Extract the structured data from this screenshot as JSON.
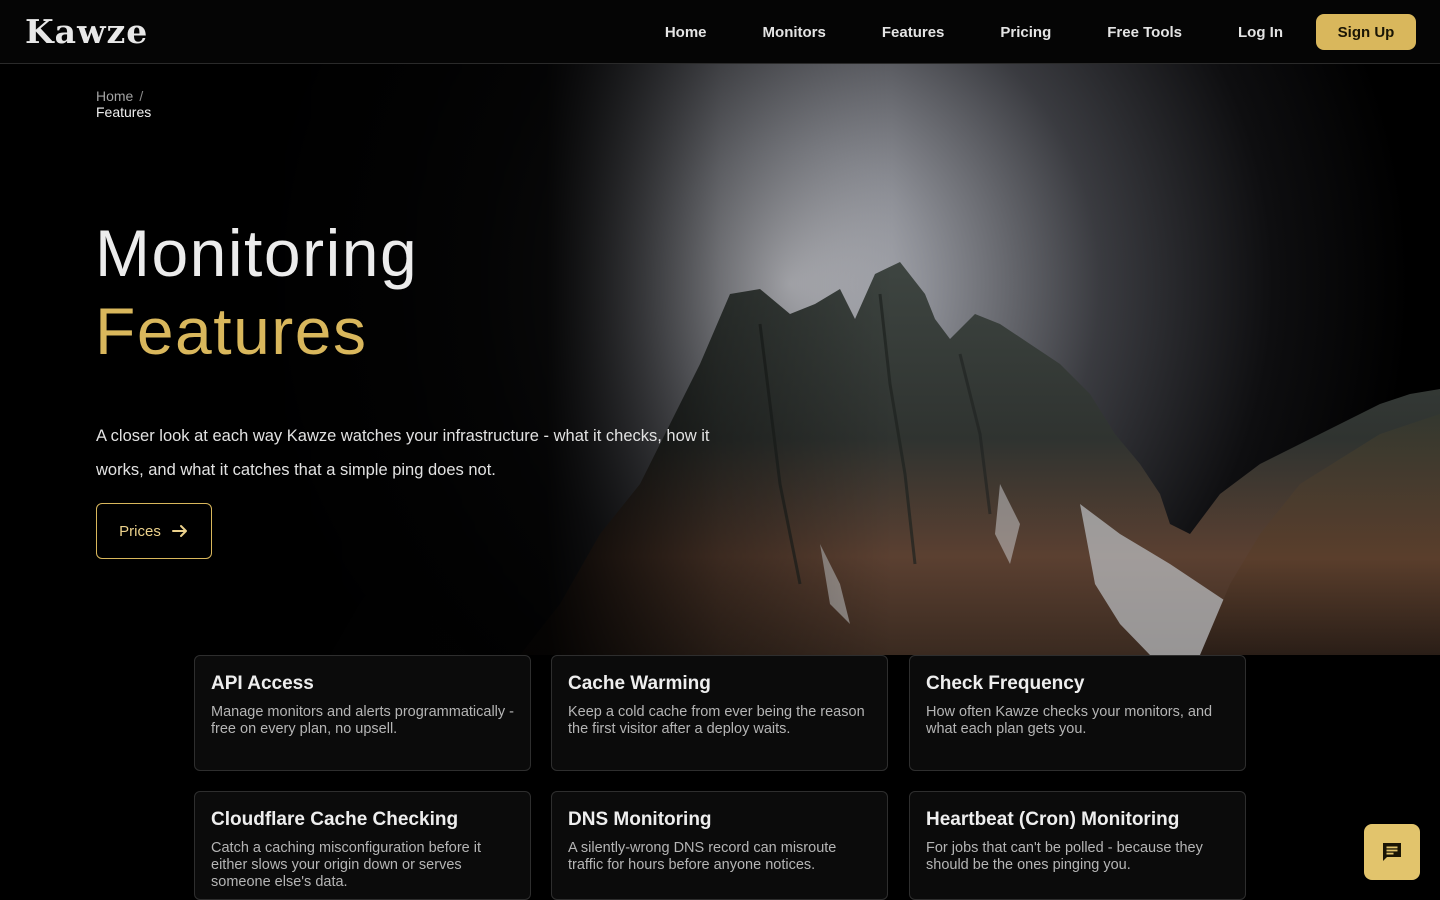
{
  "brand": {
    "name": "Kawze",
    "accent": "#d9b75c"
  },
  "nav": {
    "links": [
      "Home",
      "Monitors",
      "Features",
      "Pricing",
      "Free Tools"
    ],
    "login": "Log In",
    "signup": "Sign Up"
  },
  "breadcrumb": {
    "home": "Home",
    "separator": "/",
    "current": "Features"
  },
  "hero": {
    "title_line1": "Monitoring",
    "title_line2": "Features",
    "description": "A closer look at each way Kawze watches your infrastructure - what it checks, how it works, and what it catches that a simple ping does not.",
    "cta": "Prices",
    "cta_icon": "arrow-right-icon"
  },
  "cards": [
    {
      "title": "API Access",
      "description": "Manage monitors and alerts programmatically - free on every plan, no upsell."
    },
    {
      "title": "Cache Warming",
      "description": "Keep a cold cache from ever being the reason the first visitor after a deploy waits."
    },
    {
      "title": "Check Frequency",
      "description": "How often Kawze checks your monitors, and what each plan gets you."
    },
    {
      "title": "Cloudflare Cache Checking",
      "description": "Catch a caching misconfiguration before it either slows your origin down or serves someone else's data."
    },
    {
      "title": "DNS Monitoring",
      "description": "A silently-wrong DNS record can misroute traffic for hours before anyone notices."
    },
    {
      "title": "Heartbeat (Cron) Monitoring",
      "description": "For jobs that can't be polled - because they should be the ones pinging you."
    }
  ],
  "chat": {
    "icon": "chat-icon"
  }
}
